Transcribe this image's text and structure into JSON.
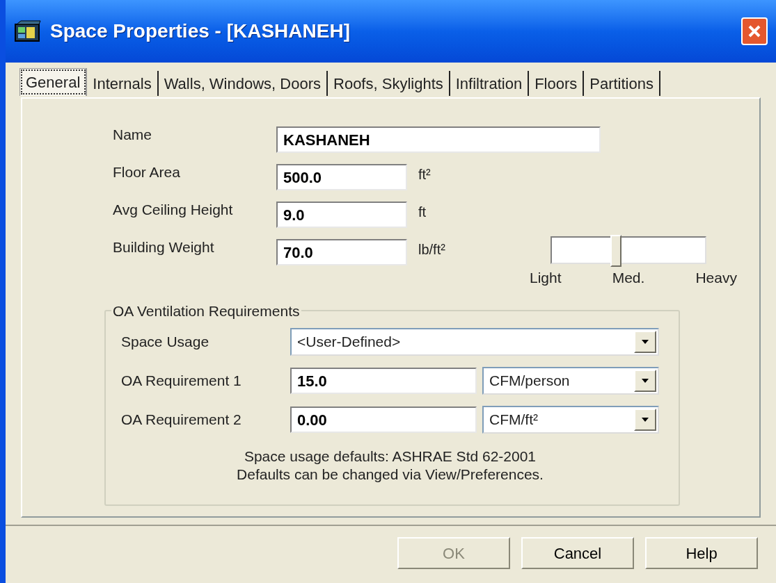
{
  "window": {
    "title": "Space Properties - [KASHANEH]"
  },
  "tabs": [
    {
      "label": "General",
      "selected": true
    },
    {
      "label": "Internals",
      "selected": false
    },
    {
      "label": "Walls, Windows, Doors",
      "selected": false
    },
    {
      "label": "Roofs, Skylights",
      "selected": false
    },
    {
      "label": "Infiltration",
      "selected": false
    },
    {
      "label": "Floors",
      "selected": false
    },
    {
      "label": "Partitions",
      "selected": false
    }
  ],
  "fields": [
    {
      "label": "Name",
      "value": "KASHANEH",
      "kind": "wide"
    },
    {
      "label": "Floor Area",
      "value": "500.0",
      "unit": "ft²",
      "kind": "short"
    },
    {
      "label": "Avg Ceiling Height",
      "value": "9.0",
      "unit": "ft",
      "kind": "short"
    },
    {
      "label": "Building Weight",
      "value": "70.0",
      "unit": "lb/ft²",
      "kind": "short"
    }
  ],
  "weight_slider": {
    "level": 0.42,
    "ticks": [
      "Light",
      "Med.",
      "Heavy"
    ]
  },
  "ventilation": {
    "title": "OA Ventilation Requirements",
    "space_usage": {
      "label": "Space Usage",
      "value": "<User-Defined>"
    },
    "requirements": [
      {
        "label": "OA Requirement 1",
        "value": "15.0",
        "unit": "CFM/person"
      },
      {
        "label": "OA Requirement 2",
        "value": "0.00",
        "unit": "CFM/ft²"
      }
    ],
    "notes": [
      "Space usage defaults: ASHRAE Std 62-2001",
      "Defaults can be changed via View/Preferences."
    ]
  },
  "buttons": [
    {
      "label": "OK",
      "disabled": true
    },
    {
      "label": "Cancel",
      "disabled": false
    },
    {
      "label": "Help",
      "disabled": false
    }
  ]
}
